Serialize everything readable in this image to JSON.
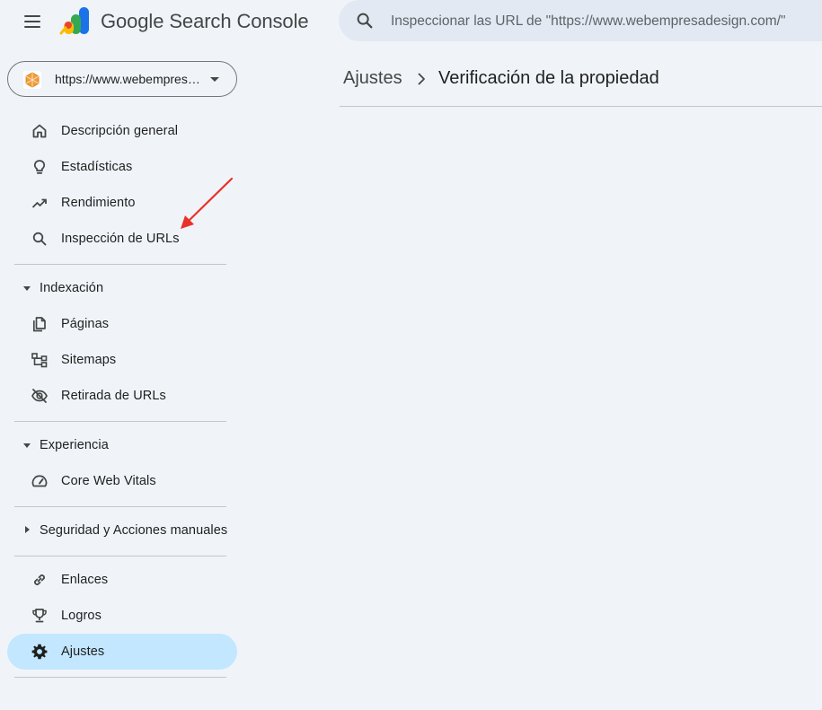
{
  "header": {
    "menu_icon": "hamburger-menu-icon",
    "logo_icon": "search-console-logo",
    "title": "Google Search Console",
    "search": {
      "icon": "search-icon",
      "placeholder": "Inspeccionar las URL de \"https://www.webempresadesign.com/\""
    }
  },
  "property_selector": {
    "favicon": "site-favicon",
    "label": "https://www.webempresadesign.com/",
    "icon": "dropdown-caret-icon"
  },
  "sidebar": {
    "items": [
      {
        "label": "Descripción general",
        "icon": "home-icon"
      },
      {
        "label": "Estadísticas",
        "icon": "lightbulb-icon"
      },
      {
        "label": "Rendimiento",
        "icon": "trending-up-icon"
      },
      {
        "label": "Inspección de URLs",
        "icon": "search-icon"
      }
    ],
    "sections": [
      {
        "label": "Indexación",
        "expanded": true,
        "items": [
          {
            "label": "Páginas",
            "icon": "pages-icon"
          },
          {
            "label": "Sitemaps",
            "icon": "sitemap-icon"
          },
          {
            "label": "Retirada de URLs",
            "icon": "visibility-off-icon"
          }
        ]
      },
      {
        "label": "Experiencia",
        "expanded": true,
        "items": [
          {
            "label": "Core Web Vitals",
            "icon": "speed-gauge-icon"
          }
        ]
      },
      {
        "label": "Seguridad y Acciones manuales",
        "expanded": false,
        "items": []
      }
    ],
    "bottom_items": [
      {
        "label": "Enlaces",
        "icon": "link-icon"
      },
      {
        "label": "Logros",
        "icon": "trophy-icon"
      },
      {
        "label": "Ajustes",
        "icon": "gear-icon",
        "active": true
      }
    ]
  },
  "breadcrumb": {
    "root": "Ajustes",
    "separator_icon": "chevron-right-icon",
    "current": "Verificación de la propiedad"
  },
  "annotation": {
    "arrow_color": "#e8322a",
    "arrow_icon": "red-arrow-annotation"
  },
  "colors": {
    "background": "#f0f4f9",
    "search_bg": "#e3e9f2",
    "active_item": "#c2e7ff",
    "divider": "#c4c7c5"
  }
}
